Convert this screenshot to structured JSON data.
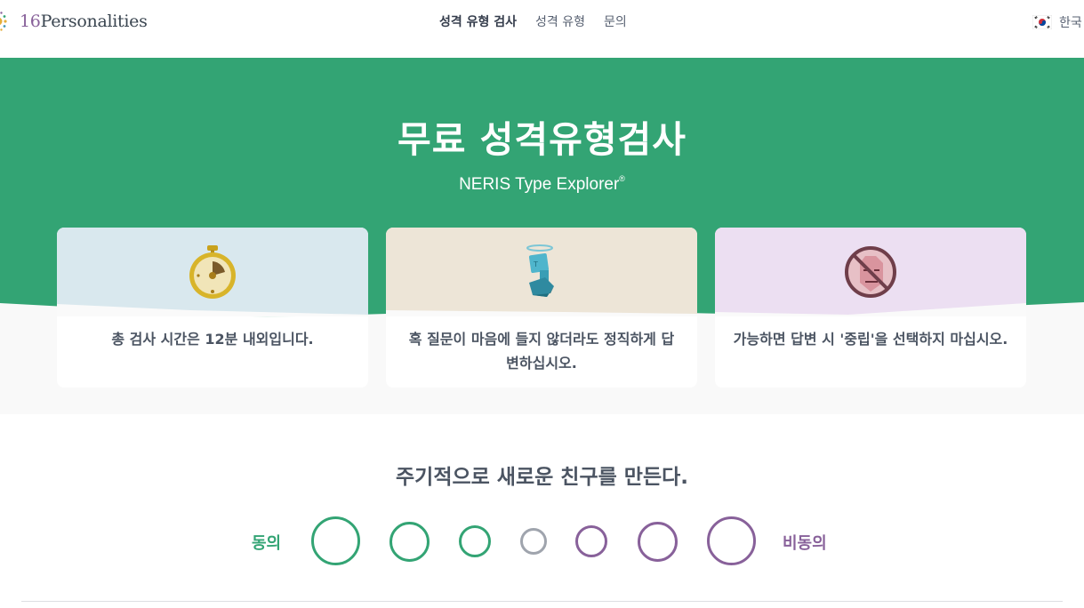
{
  "header": {
    "logo_number": "16",
    "logo_word": "Personalities",
    "nav": [
      "성격 유형 검사",
      "성격 유형",
      "문의"
    ],
    "language": "한국"
  },
  "hero": {
    "title": "무료 성격유형검사",
    "subtitle": "NERIS Type Explorer",
    "subtitle_mark": "®"
  },
  "cards": [
    {
      "icon": "stopwatch-icon",
      "text": "총 검사 시간은 12분 내외입니다."
    },
    {
      "icon": "halo-figure-icon",
      "text": "혹 질문이 마음에 들지 않더라도 정직하게 답변하십시오."
    },
    {
      "icon": "no-neutral-face-icon",
      "text": "가능하면 답변 시 '중립'을 선택하지 마십시오."
    }
  ],
  "question": {
    "text": "주기적으로 새로운 친구를 만든다.",
    "agree_label": "동의",
    "disagree_label": "비동의",
    "option_count": 7
  },
  "colors": {
    "green": "#33a474",
    "purple": "#88619a",
    "neutral": "#9fa4ad",
    "text": "#4b5462"
  }
}
